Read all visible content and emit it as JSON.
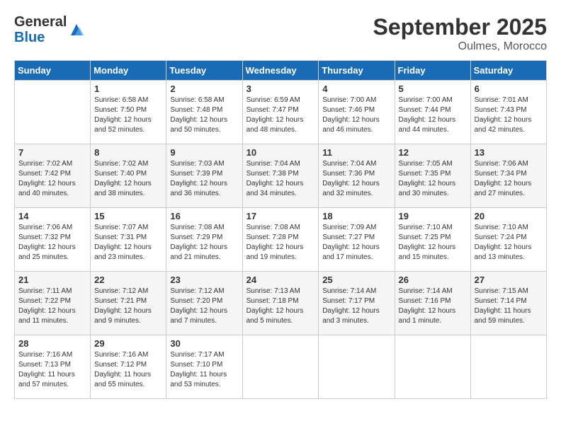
{
  "header": {
    "logo_general": "General",
    "logo_blue": "Blue",
    "month_title": "September 2025",
    "location": "Oulmes, Morocco"
  },
  "calendar": {
    "days_of_week": [
      "Sunday",
      "Monday",
      "Tuesday",
      "Wednesday",
      "Thursday",
      "Friday",
      "Saturday"
    ],
    "weeks": [
      [
        {
          "day": "",
          "info": ""
        },
        {
          "day": "1",
          "info": "Sunrise: 6:58 AM\nSunset: 7:50 PM\nDaylight: 12 hours\nand 52 minutes."
        },
        {
          "day": "2",
          "info": "Sunrise: 6:58 AM\nSunset: 7:48 PM\nDaylight: 12 hours\nand 50 minutes."
        },
        {
          "day": "3",
          "info": "Sunrise: 6:59 AM\nSunset: 7:47 PM\nDaylight: 12 hours\nand 48 minutes."
        },
        {
          "day": "4",
          "info": "Sunrise: 7:00 AM\nSunset: 7:46 PM\nDaylight: 12 hours\nand 46 minutes."
        },
        {
          "day": "5",
          "info": "Sunrise: 7:00 AM\nSunset: 7:44 PM\nDaylight: 12 hours\nand 44 minutes."
        },
        {
          "day": "6",
          "info": "Sunrise: 7:01 AM\nSunset: 7:43 PM\nDaylight: 12 hours\nand 42 minutes."
        }
      ],
      [
        {
          "day": "7",
          "info": "Sunrise: 7:02 AM\nSunset: 7:42 PM\nDaylight: 12 hours\nand 40 minutes."
        },
        {
          "day": "8",
          "info": "Sunrise: 7:02 AM\nSunset: 7:40 PM\nDaylight: 12 hours\nand 38 minutes."
        },
        {
          "day": "9",
          "info": "Sunrise: 7:03 AM\nSunset: 7:39 PM\nDaylight: 12 hours\nand 36 minutes."
        },
        {
          "day": "10",
          "info": "Sunrise: 7:04 AM\nSunset: 7:38 PM\nDaylight: 12 hours\nand 34 minutes."
        },
        {
          "day": "11",
          "info": "Sunrise: 7:04 AM\nSunset: 7:36 PM\nDaylight: 12 hours\nand 32 minutes."
        },
        {
          "day": "12",
          "info": "Sunrise: 7:05 AM\nSunset: 7:35 PM\nDaylight: 12 hours\nand 30 minutes."
        },
        {
          "day": "13",
          "info": "Sunrise: 7:06 AM\nSunset: 7:34 PM\nDaylight: 12 hours\nand 27 minutes."
        }
      ],
      [
        {
          "day": "14",
          "info": "Sunrise: 7:06 AM\nSunset: 7:32 PM\nDaylight: 12 hours\nand 25 minutes."
        },
        {
          "day": "15",
          "info": "Sunrise: 7:07 AM\nSunset: 7:31 PM\nDaylight: 12 hours\nand 23 minutes."
        },
        {
          "day": "16",
          "info": "Sunrise: 7:08 AM\nSunset: 7:29 PM\nDaylight: 12 hours\nand 21 minutes."
        },
        {
          "day": "17",
          "info": "Sunrise: 7:08 AM\nSunset: 7:28 PM\nDaylight: 12 hours\nand 19 minutes."
        },
        {
          "day": "18",
          "info": "Sunrise: 7:09 AM\nSunset: 7:27 PM\nDaylight: 12 hours\nand 17 minutes."
        },
        {
          "day": "19",
          "info": "Sunrise: 7:10 AM\nSunset: 7:25 PM\nDaylight: 12 hours\nand 15 minutes."
        },
        {
          "day": "20",
          "info": "Sunrise: 7:10 AM\nSunset: 7:24 PM\nDaylight: 12 hours\nand 13 minutes."
        }
      ],
      [
        {
          "day": "21",
          "info": "Sunrise: 7:11 AM\nSunset: 7:22 PM\nDaylight: 12 hours\nand 11 minutes."
        },
        {
          "day": "22",
          "info": "Sunrise: 7:12 AM\nSunset: 7:21 PM\nDaylight: 12 hours\nand 9 minutes."
        },
        {
          "day": "23",
          "info": "Sunrise: 7:12 AM\nSunset: 7:20 PM\nDaylight: 12 hours\nand 7 minutes."
        },
        {
          "day": "24",
          "info": "Sunrise: 7:13 AM\nSunset: 7:18 PM\nDaylight: 12 hours\nand 5 minutes."
        },
        {
          "day": "25",
          "info": "Sunrise: 7:14 AM\nSunset: 7:17 PM\nDaylight: 12 hours\nand 3 minutes."
        },
        {
          "day": "26",
          "info": "Sunrise: 7:14 AM\nSunset: 7:16 PM\nDaylight: 12 hours\nand 1 minute."
        },
        {
          "day": "27",
          "info": "Sunrise: 7:15 AM\nSunset: 7:14 PM\nDaylight: 11 hours\nand 59 minutes."
        }
      ],
      [
        {
          "day": "28",
          "info": "Sunrise: 7:16 AM\nSunset: 7:13 PM\nDaylight: 11 hours\nand 57 minutes."
        },
        {
          "day": "29",
          "info": "Sunrise: 7:16 AM\nSunset: 7:12 PM\nDaylight: 11 hours\nand 55 minutes."
        },
        {
          "day": "30",
          "info": "Sunrise: 7:17 AM\nSunset: 7:10 PM\nDaylight: 11 hours\nand 53 minutes."
        },
        {
          "day": "",
          "info": ""
        },
        {
          "day": "",
          "info": ""
        },
        {
          "day": "",
          "info": ""
        },
        {
          "day": "",
          "info": ""
        }
      ]
    ]
  }
}
